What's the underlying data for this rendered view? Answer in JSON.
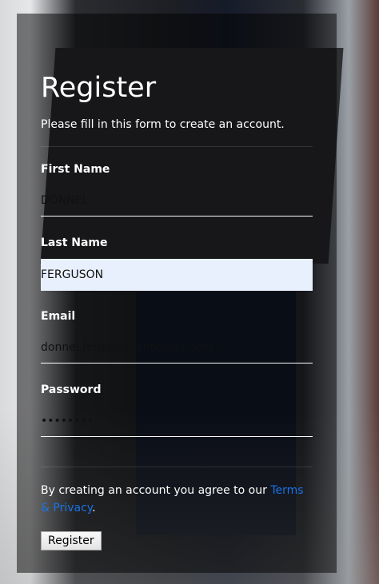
{
  "form": {
    "title": "Register",
    "subtitle": "Please fill in this form to create an account.",
    "fields": [
      {
        "label": "First Name",
        "value": "DONNEL"
      },
      {
        "label": "Last Name",
        "value": "FERGUSON"
      },
      {
        "label": "Email",
        "value": "donnel.ferguson@hotmail.com"
      },
      {
        "label": "Password",
        "value": "••••••••"
      }
    ],
    "agree_text": "By creating an account you agree to our ",
    "terms_link": "Terms & Privacy",
    "agree_end": ".",
    "submit_label": "Register",
    "link_color": "#1a73e8",
    "autofill_color": "#e8f0fe"
  }
}
